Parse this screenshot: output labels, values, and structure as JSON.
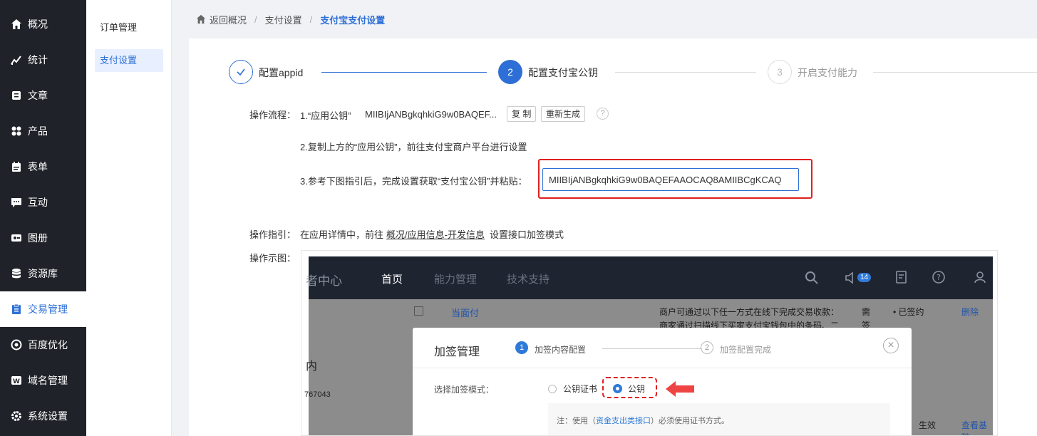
{
  "sidebar": {
    "items": [
      {
        "label": "概况",
        "icon": "home-icon"
      },
      {
        "label": "统计",
        "icon": "chart-icon"
      },
      {
        "label": "文章",
        "icon": "article-icon"
      },
      {
        "label": "产品",
        "icon": "grid-icon"
      },
      {
        "label": "表单",
        "icon": "form-icon"
      },
      {
        "label": "互动",
        "icon": "chat-icon"
      },
      {
        "label": "图册",
        "icon": "album-icon"
      },
      {
        "label": "资源库",
        "icon": "database-icon"
      },
      {
        "label": "交易管理",
        "icon": "trade-icon"
      },
      {
        "label": "百度优化",
        "icon": "seo-icon"
      },
      {
        "label": "域名管理",
        "icon": "domain-icon"
      },
      {
        "label": "系统设置",
        "icon": "gear-icon"
      }
    ]
  },
  "submenu": {
    "items": [
      {
        "label": "订单管理"
      },
      {
        "label": "支付设置"
      }
    ]
  },
  "breadcrumb": {
    "back": "返回概况",
    "level1": "支付设置",
    "current": "支付宝支付设置"
  },
  "steps": [
    {
      "num": "✓",
      "label": "配置appid"
    },
    {
      "num": "2",
      "label": "配置支付宝公钥"
    },
    {
      "num": "3",
      "label": "开启支付能力"
    }
  ],
  "flow": {
    "label": "操作流程：",
    "step1_prefix": "1.“应用公钥”",
    "step1_key": "MIIBIjANBgkqhkiG9w0BAQEF...",
    "copy_btn": "复 制",
    "regen_btn": "重新生成",
    "help": "?",
    "step2": "2.复制上方的“应用公钥”，前往支付宝商户平台进行设置",
    "step3": "3.参考下图指引后，完成设置获取“支付宝公钥”并粘贴：",
    "input_value": "MIIBIjANBgkqhkiG9w0BAQEFAAOCAQ8AMIIBCgKCAQ"
  },
  "guide": {
    "label": "操作指引：",
    "text_before": "在应用详情中，前往",
    "link": "概况/应用信息-开发信息",
    "text_after": "设置接口加签模式"
  },
  "demo": {
    "label": "操作示图：",
    "top_title": "者中心",
    "nav": [
      "首页",
      "能力管理",
      "技术支持"
    ],
    "badge": "14",
    "row_link": "当面付",
    "row_desc1": "商户可通过以下任一方式在线下完成交易收款：",
    "row_desc2": "商家通过扫描线下买家支付宝钱包中的条码、二",
    "row_need": "需",
    "row_need2": "签",
    "row_status": "• 已签约",
    "row_delete": "删除",
    "left_char": "内",
    "left_num": "767043",
    "bottom_right1": "生效",
    "bottom_right2": "查看基础",
    "dialog": {
      "title": "加签管理",
      "step1_num": "1",
      "step1_label": "加签内容配置",
      "step2_num": "2",
      "step2_label": "加签配置完成",
      "close": "×",
      "mode_label": "选择加签模式：",
      "opt1": "公钥证书",
      "opt2": "公钥",
      "note_prefix": "注：使用（",
      "note_link": "资金支出类接口",
      "note_suffix": "）必须使用证书方式。"
    }
  }
}
